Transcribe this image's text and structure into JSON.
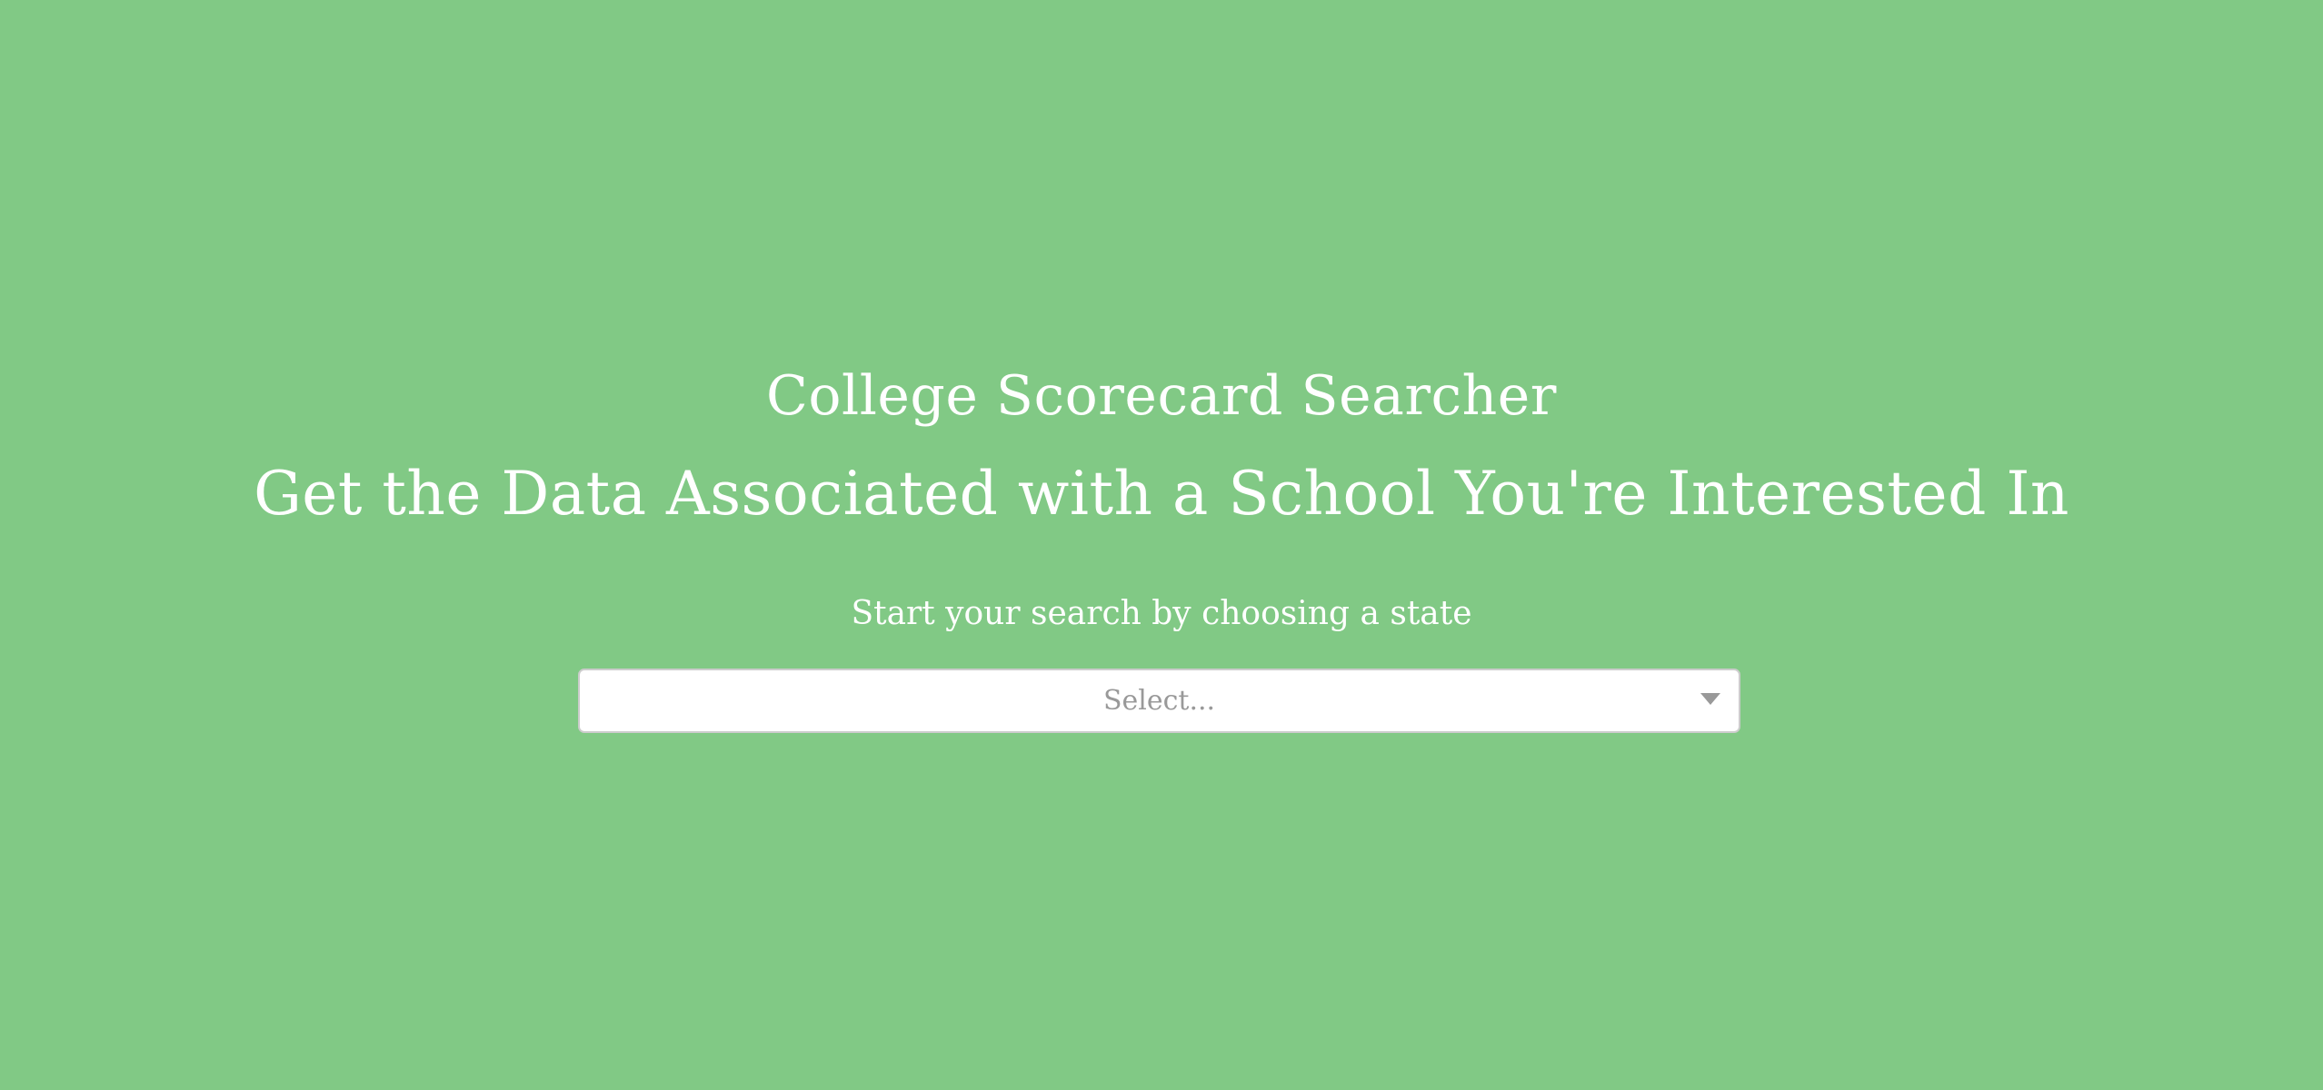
{
  "hero": {
    "title": "College Scorecard Searcher",
    "subtitle": "Get the Data Associated with a School You're Interested In",
    "prompt": "Start your search by choosing a state"
  },
  "state_select": {
    "placeholder": "Select...",
    "icon": "chevron-down-icon"
  },
  "colors": {
    "background": "#81c985",
    "text": "#ffffff",
    "select_background": "#ffffff",
    "select_border": "#cccccc",
    "placeholder": "#999999"
  }
}
